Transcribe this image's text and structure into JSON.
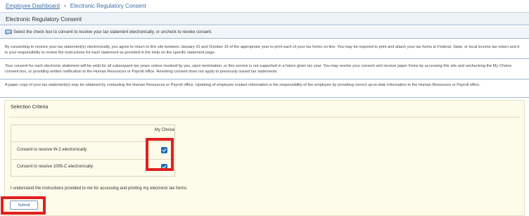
{
  "breadcrumb": {
    "home": "Employee Dashboard",
    "separator": "•",
    "current": "Electronic Regulatory Consent"
  },
  "page_title": "Electronic Regulatory Consent",
  "instruction": {
    "icon": "info-message-icon",
    "text": "Select the check box to consent to receive your tax statement electronically, or uncheck to revoke consent."
  },
  "paragraphs": [
    "By consenting to receive your tax statement(s) electronically, you agree to return to this site between January 31 and October 15 of the appropriate year to print each of your tax forms on-line. You may be required to print and attach your tax forms to Federal, State, or local income tax return and it is your responsibility to review the instructions for each statement as provided in the Help on the specific statement page.",
    "Your consent for each electronic statement will be valid for all subsequent tax years unless revoked by you, upon termination, or this service is not supported in a future given tax year. You may revoke your consent and receive paper forms by accessing this site and unchecking the My Choice consent box, or providing written notification to the Human Resources or Payroll office. Revoking consent does not apply to previously issued tax statements.",
    "A paper copy of your tax statement(s) may be obtained by contacting the Human Resources or Payroll office. Updating of employee contact information is the responsibility of the employee by providing correct up-to-date information to the Human Resources or Payroll office."
  ],
  "selection": {
    "heading": "Selection Criteria",
    "column_header": "My Choice",
    "rows": [
      {
        "label": "Consent to receive W-2 electronically:",
        "checked": true
      },
      {
        "label": "Consent to receive 1095-C electronically:",
        "checked": true
      }
    ]
  },
  "acknowledgement": "I understand the instructions provided to me for accessing and printing my electronic tax forms.",
  "submit_label": "Submit",
  "colors": {
    "accent": "#1f6fb8",
    "highlight": "#e02020",
    "panel_bg": "#fdfbe9"
  }
}
